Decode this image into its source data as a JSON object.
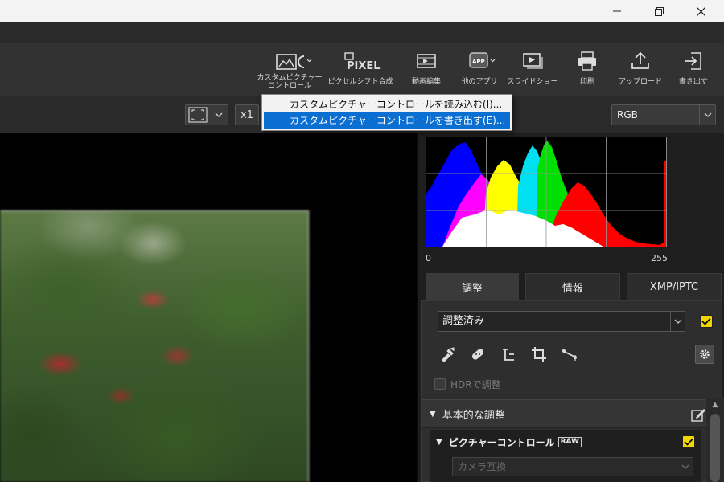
{
  "window": {
    "minimize_label": "—",
    "maximize_label": "❐",
    "close_label": "✕"
  },
  "toolbar": {
    "picture_control": {
      "label_line1": "カスタムピクチャー",
      "label_line2": "コントロール",
      "icon": "picture-control-icon"
    },
    "pixel_shift": {
      "label": "ピクセルシフト合成",
      "icon_text": "PIXEL"
    },
    "movie_edit": {
      "label": "動画編集"
    },
    "other_apps": {
      "label": "他のアプリ",
      "badge": "APP"
    },
    "slideshow": {
      "label": "スライドショー"
    },
    "print": {
      "label": "印刷"
    },
    "upload": {
      "label": "アップロード"
    },
    "export": {
      "label": "書き出す"
    }
  },
  "dropdown_menu": {
    "items": [
      {
        "label": "カスタムピクチャーコントロールを読み込む(I)..."
      },
      {
        "label": "カスタムピクチャーコントロールを書き出す(E)...",
        "highlighted": true
      }
    ]
  },
  "viewbar": {
    "zoom_label": "x1",
    "channel_value": "RGB"
  },
  "histogram": {
    "min_label": "0",
    "max_label": "255"
  },
  "panel": {
    "tabs": [
      {
        "label": "調整",
        "active": true
      },
      {
        "label": "情報"
      },
      {
        "label": "XMP/IPTC"
      }
    ],
    "preset_value": "調整済み",
    "hdr_label": "HDRで調整",
    "basic_section": "基本的な調整",
    "picture_control_section": "ピクチャーコントロール",
    "raw_badge": "RAW",
    "camera_setting_value": "カメラ互換"
  },
  "colors": {
    "accent_blue": "#0b6ed1",
    "checkbox_yellow": "#f2d600"
  }
}
